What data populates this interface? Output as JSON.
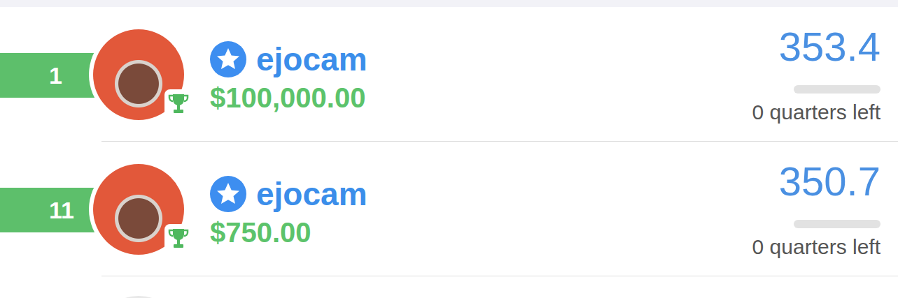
{
  "rows": [
    {
      "rank": "1",
      "name": "ejocam",
      "prize": "$100,000.00",
      "score": "353.4",
      "level": 0,
      "quarters": "0 quarters left"
    },
    {
      "rank": "11",
      "name": "ejocam",
      "prize": "$750.00",
      "score": "350.7",
      "level": 0,
      "quarters": "0 quarters left"
    }
  ]
}
